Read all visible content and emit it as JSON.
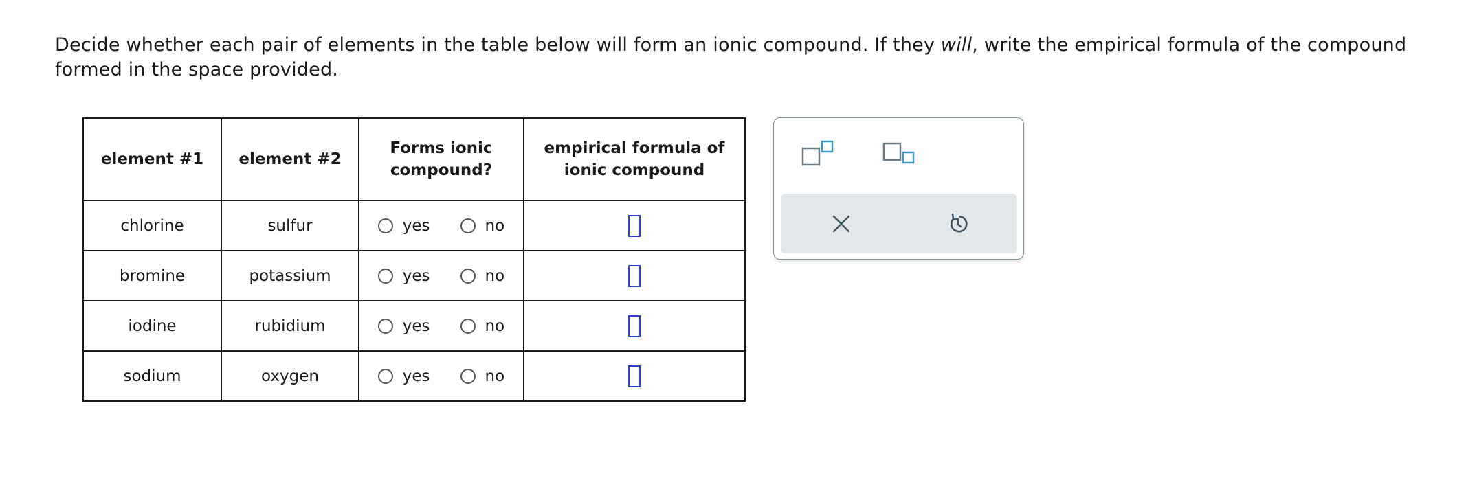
{
  "question": {
    "part1": "Decide whether each pair of elements in the table below will form an ionic compound. If they ",
    "emphasis": "will",
    "part2": ", write the empirical formula of the compound formed in the space provided."
  },
  "table": {
    "headers": {
      "element1": "element #1",
      "element2": "element #2",
      "forms_line1": "Forms ionic",
      "forms_line2": "compound?",
      "formula_line1": "empirical formula of",
      "formula_line2": "ionic compound"
    },
    "rows": [
      {
        "element1": "chlorine",
        "element2": "sulfur",
        "yes": "yes",
        "no": "no"
      },
      {
        "element1": "bromine",
        "element2": "potassium",
        "yes": "yes",
        "no": "no"
      },
      {
        "element1": "iodine",
        "element2": "rubidium",
        "yes": "yes",
        "no": "no"
      },
      {
        "element1": "sodium",
        "element2": "oxygen",
        "yes": "yes",
        "no": "no"
      }
    ]
  },
  "palette": {
    "tools": [
      "superscript-icon",
      "subscript-icon"
    ],
    "actions": [
      "close-icon",
      "undo-icon"
    ]
  },
  "colors": {
    "answer_box": "#2e3fd6",
    "tool_small_box": "#3a9cc2",
    "tool_big_box": "#6c7a83",
    "palette_bar": "#e2e8ea",
    "action_icon": "#3e5460"
  }
}
